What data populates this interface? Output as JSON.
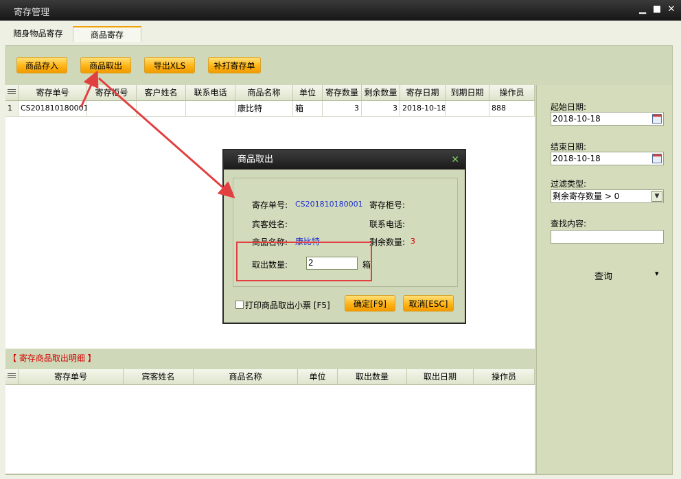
{
  "window": {
    "title": "寄存管理",
    "minimize": "▁",
    "maximize": "■",
    "close": "✕"
  },
  "tabs": [
    {
      "label": "随身物品寄存"
    },
    {
      "label": "商品寄存"
    }
  ],
  "toolbar": {
    "store": "商品存入",
    "takeout": "商品取出",
    "export": "导出XLS",
    "reprint": "补打寄存单"
  },
  "grid": {
    "headers": [
      "寄存单号",
      "寄存柜号",
      "客户姓名",
      "联系电话",
      "商品名称",
      "单位",
      "寄存数量",
      "剩余数量",
      "寄存日期",
      "到期日期",
      "操作员"
    ],
    "row": {
      "idx": "1",
      "order": "CS201810180001",
      "cabinet": "",
      "customer": "",
      "phone": "",
      "product": "康比特",
      "unit": "箱",
      "qty": "3",
      "remain": "3",
      "date": "2018-10-18",
      "expire": "",
      "operator": "888"
    }
  },
  "filters": {
    "start_label": "起始日期:",
    "start_value": "2018-10-18",
    "end_label": "结束日期:",
    "end_value": "2018-10-18",
    "type_label": "过滤类型:",
    "type_value": "剩余寄存数量 > 0",
    "search_label": "查找内容:",
    "search_value": "",
    "query": "查询",
    "query_arrow": "▾"
  },
  "detail": {
    "title": "【 寄存商品取出明细 】",
    "headers": [
      "寄存单号",
      "宾客姓名",
      "商品名称",
      "单位",
      "取出数量",
      "取出日期",
      "操作员"
    ]
  },
  "dialog": {
    "title": "商品取出",
    "close": "✕",
    "order_label": "寄存单号:",
    "order_value": "CS201810180001",
    "cabinet_label": "寄存柜号:",
    "guest_label": "宾客姓名:",
    "phone_label": "联系电话:",
    "product_label": "商品名称:",
    "product_value": "康比特",
    "remain_label": "剩余数量:",
    "remain_value": "3",
    "takeout_label": "取出数量:",
    "takeout_value": "2",
    "unit": "箱",
    "print_label": "打印商品取出小票 [F5]",
    "ok": "确定[F9]",
    "cancel": "取消[ESC]"
  },
  "colors": {
    "accent_orange": "#ffb416",
    "annotation_red": "#e24040",
    "value_blue": "#1a2fcf",
    "value_red": "#d40000"
  }
}
